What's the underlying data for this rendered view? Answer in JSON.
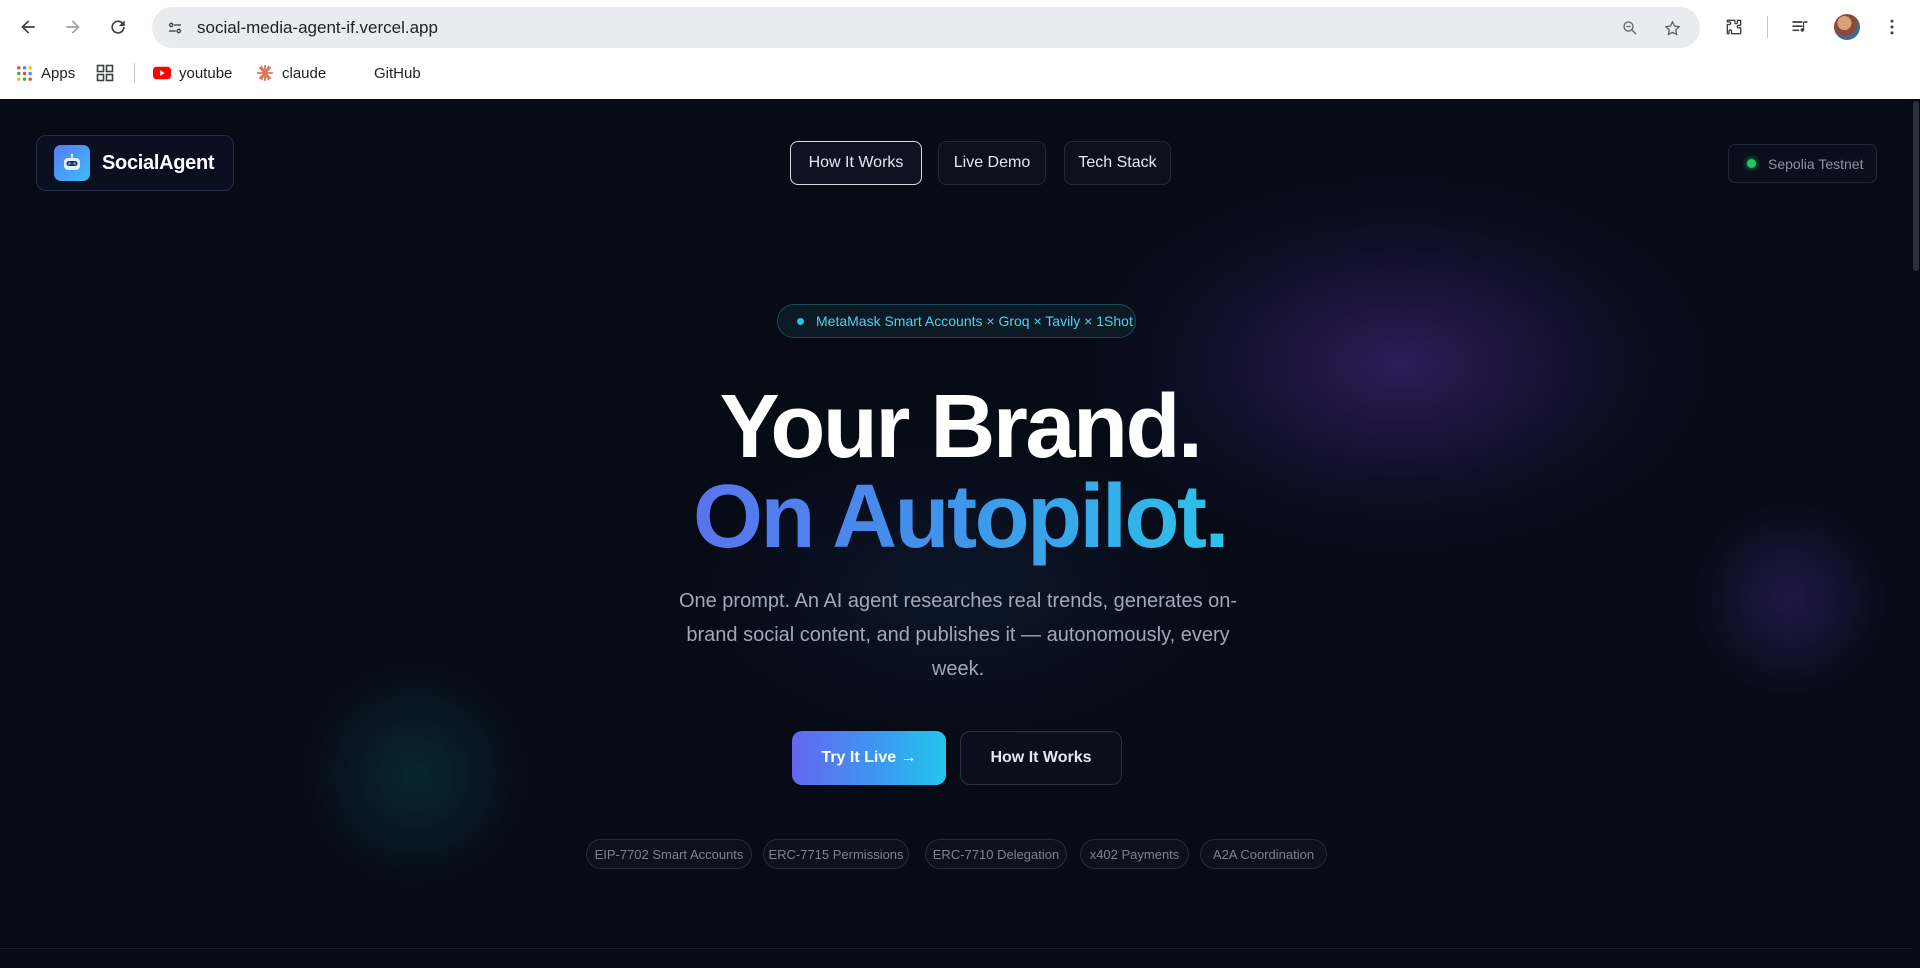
{
  "browser": {
    "url": "social-media-agent-if.vercel.app",
    "bookmarks": [
      {
        "label": "Apps",
        "icon": "apps-grid-icon"
      },
      {
        "label": "",
        "icon": "tab-groups-icon"
      },
      {
        "label": "youtube",
        "icon": "youtube-icon"
      },
      {
        "label": "claude",
        "icon": "claude-icon"
      },
      {
        "label": "GitHub",
        "icon": "github-icon"
      }
    ]
  },
  "header": {
    "logo_text": "SocialAgent",
    "nav": [
      "How It Works",
      "Live Demo",
      "Tech Stack"
    ],
    "network_label": "Sepolia Testnet"
  },
  "hero": {
    "badge": "MetaMask Smart Accounts × Groq × Tavily × 1Shot",
    "title_line1": "Your Brand.",
    "title_line2": "On Autopilot.",
    "subtitle": "One prompt. An AI agent researches real trends, generates on-brand social content, and publishes it — autonomously, every week.",
    "cta_primary": "Try It Live →",
    "cta_secondary": "How It Works",
    "tags": [
      "EIP-7702 Smart Accounts",
      "ERC-7715 Permissions",
      "ERC-7710 Delegation",
      "x402 Payments",
      "A2A Coordination"
    ]
  },
  "colors": {
    "accent_start": "#6366f1",
    "accent_end": "#22c7ec",
    "status_green": "#22c55e",
    "background": "#070b16"
  }
}
